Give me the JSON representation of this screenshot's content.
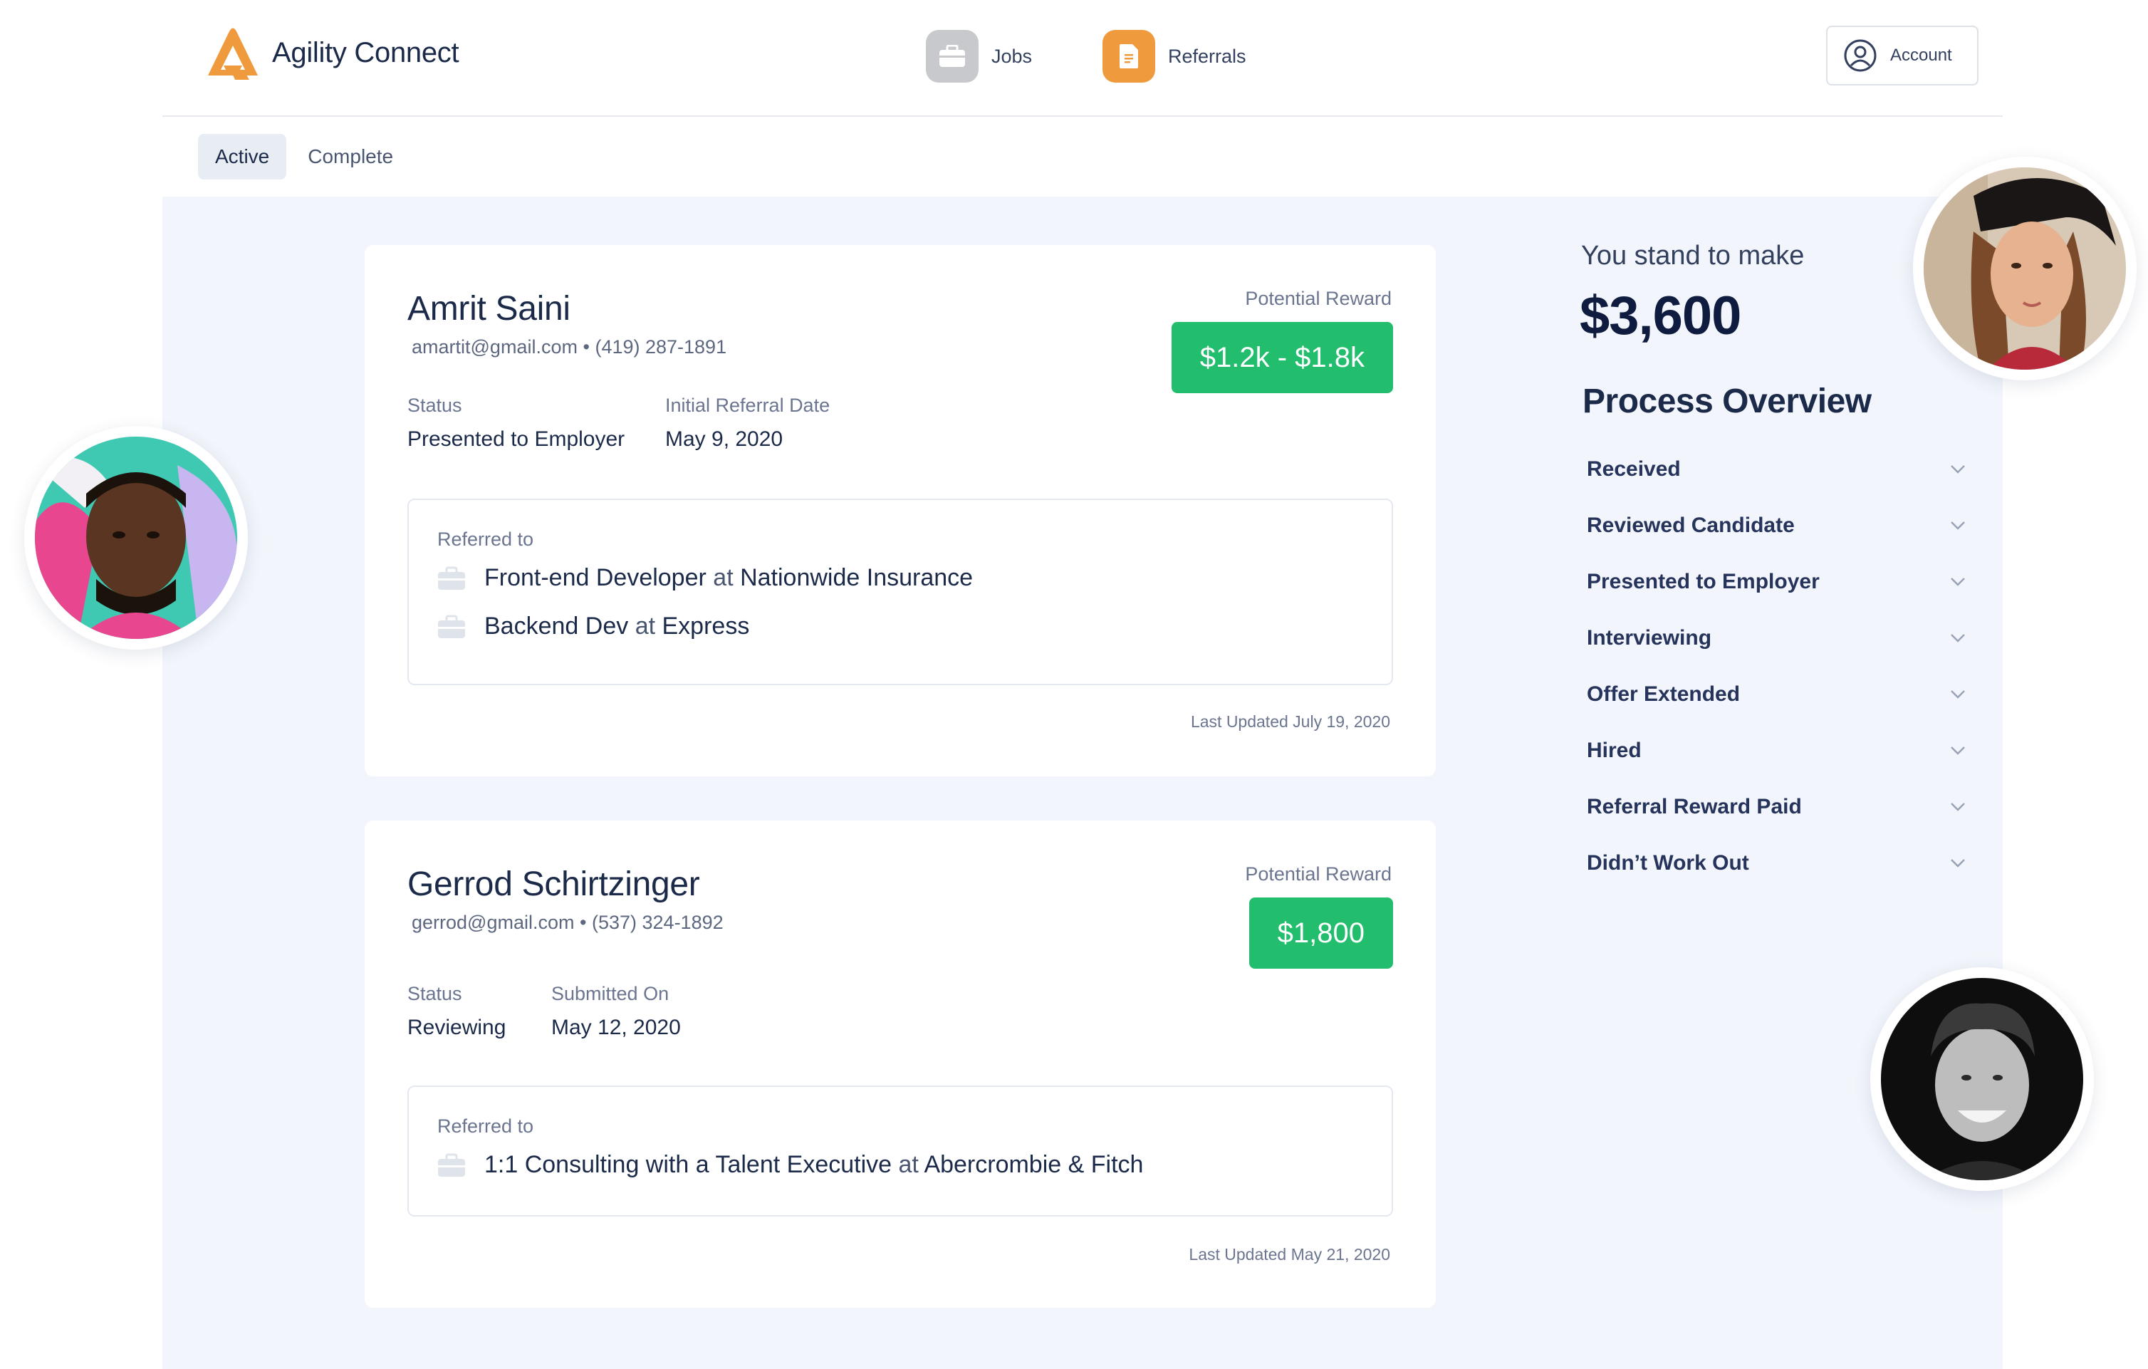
{
  "brand": {
    "name": "Agility Connect"
  },
  "nav": {
    "jobs": {
      "label": "Jobs",
      "icon": "briefcase-icon"
    },
    "referrals": {
      "label": "Referrals",
      "icon": "document-icon"
    },
    "account": {
      "label": "Account",
      "icon": "user-circle-icon"
    }
  },
  "tabs": [
    {
      "label": "Active",
      "active": true
    },
    {
      "label": "Complete",
      "active": false
    }
  ],
  "referrals": [
    {
      "name": "Amrit Saini",
      "email": "amartit@gmail.com",
      "separator": "•",
      "phone": "(419) 287-1891",
      "fields": [
        {
          "label": "Status",
          "value": "Presented to Employer"
        },
        {
          "label": "Initial Referral Date",
          "value": "May 9, 2020"
        }
      ],
      "reward_label": "Potential Reward",
      "reward": "$1.2k - $1.8k",
      "referred_to_label": "Referred to",
      "referred_to": [
        {
          "role": "Front-end Developer",
          "at": "at",
          "company": "Nationwide Insurance"
        },
        {
          "role": "Backend Dev",
          "at": "at",
          "company": "Express"
        }
      ],
      "last_updated": "Last Updated July 19, 2020"
    },
    {
      "name": "Gerrod Schirtzinger",
      "email": "gerrod@gmail.com",
      "separator": "•",
      "phone": "(537) 324-1892",
      "fields": [
        {
          "label": "Status",
          "value": "Reviewing"
        },
        {
          "label": "Submitted On",
          "value": "May 12, 2020"
        }
      ],
      "reward_label": "Potential Reward",
      "reward": "$1,800",
      "referred_to_label": "Referred to",
      "referred_to": [
        {
          "role": "1:1 Consulting with a Talent Executive",
          "at": "at",
          "company": "Abercrombie & Fitch"
        }
      ],
      "last_updated": "Last Updated May 21, 2020"
    }
  ],
  "summary": {
    "stand_label": "You stand to make",
    "amount": "$3,600",
    "overview_title": "Process Overview",
    "stages": [
      "Received",
      "Reviewed Candidate",
      "Presented to Employer",
      "Interviewing",
      "Offer Extended",
      "Hired",
      "Referral Reward Paid",
      "Didn’t Work Out"
    ]
  },
  "colors": {
    "brand_orange": "#ef9a3c",
    "reward_green": "#22bd6d",
    "navy": "#1c2a4a",
    "panel_bg": "#f2f5fb"
  }
}
